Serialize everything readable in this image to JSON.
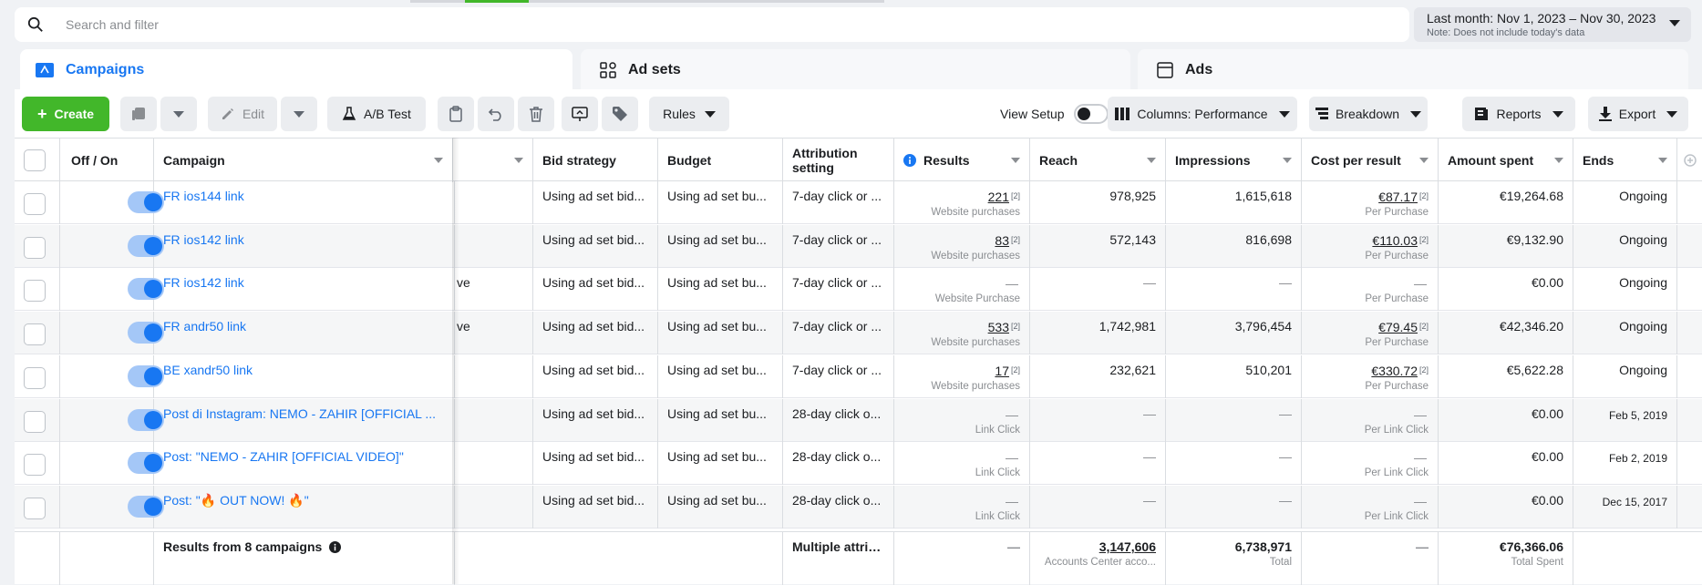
{
  "search": {
    "placeholder": "Search and filter"
  },
  "date_range": {
    "label": "Last month: Nov 1, 2023 – Nov 30, 2023",
    "note": "Note: Does not include today's data"
  },
  "tabs": [
    {
      "label": "Campaigns"
    },
    {
      "label": "Ad sets"
    },
    {
      "label": "Ads"
    }
  ],
  "toolbar": {
    "create": "Create",
    "edit": "Edit",
    "ab_test": "A/B Test",
    "rules": "Rules",
    "view_setup": "View Setup",
    "columns": "Columns: Performance",
    "breakdown": "Breakdown",
    "reports": "Reports",
    "export": "Export"
  },
  "columns": {
    "off_on": "Off / On",
    "campaign": "Campaign",
    "bid_strategy": "Bid strategy",
    "budget": "Budget",
    "attribution_line1": "Attribution",
    "attribution_line2": "setting",
    "results": "Results",
    "reach": "Reach",
    "impressions": "Impressions",
    "cost_per_result": "Cost per result",
    "amount_spent": "Amount spent",
    "ends": "Ends"
  },
  "rows": [
    {
      "name": "FR ios144 link",
      "delivery": "",
      "bid": "Using ad set bid...",
      "budget": "Using ad set bu...",
      "attribution": "7-day click or ...",
      "results": "221",
      "results_sup": "[2]",
      "results_sub": "Website purchases",
      "reach": "978,925",
      "impressions": "1,615,618",
      "cpr": "€87.17",
      "cpr_sup": "[2]",
      "cpr_sub": "Per Purchase",
      "spent": "€19,264.68",
      "ends": "Ongoing"
    },
    {
      "name": "FR ios142 link",
      "delivery": "",
      "bid": "Using ad set bid...",
      "budget": "Using ad set bu...",
      "attribution": "7-day click or ...",
      "results": "83",
      "results_sup": "[2]",
      "results_sub": "Website purchases",
      "reach": "572,143",
      "impressions": "816,698",
      "cpr": "€110.03",
      "cpr_sup": "[2]",
      "cpr_sub": "Per Purchase",
      "spent": "€9,132.90",
      "ends": "Ongoing"
    },
    {
      "name": "FR ios142 link",
      "delivery": "ve",
      "bid": "Using ad set bid...",
      "budget": "Using ad set bu...",
      "attribution": "7-day click or ...",
      "results": "—",
      "results_sup": "",
      "results_sub": "Website Purchase",
      "reach": "—",
      "impressions": "—",
      "cpr": "—",
      "cpr_sup": "",
      "cpr_sub": "Per Purchase",
      "spent": "€0.00",
      "ends": "Ongoing"
    },
    {
      "name": "FR andr50 link",
      "delivery": "ve",
      "bid": "Using ad set bid...",
      "budget": "Using ad set bu...",
      "attribution": "7-day click or ...",
      "results": "533",
      "results_sup": "[2]",
      "results_sub": "Website purchases",
      "reach": "1,742,981",
      "impressions": "3,796,454",
      "cpr": "€79.45",
      "cpr_sup": "[2]",
      "cpr_sub": "Per Purchase",
      "spent": "€42,346.20",
      "ends": "Ongoing"
    },
    {
      "name": "BE xandr50 link",
      "delivery": "",
      "bid": "Using ad set bid...",
      "budget": "Using ad set bu...",
      "attribution": "7-day click or ...",
      "results": "17",
      "results_sup": "[2]",
      "results_sub": "Website purchases",
      "reach": "232,621",
      "impressions": "510,201",
      "cpr": "€330.72",
      "cpr_sup": "[2]",
      "cpr_sub": "Per Purchase",
      "spent": "€5,622.28",
      "ends": "Ongoing"
    },
    {
      "name": "Post di Instagram: NEMO - ZAHIR [OFFICIAL ...",
      "delivery": "",
      "bid": "Using ad set bid...",
      "budget": "Using ad set bu...",
      "attribution": "28-day click o...",
      "results": "—",
      "results_sup": "",
      "results_sub": "Link Click",
      "reach": "—",
      "impressions": "—",
      "cpr": "—",
      "cpr_sup": "",
      "cpr_sub": "Per Link Click",
      "spent": "€0.00",
      "ends": "Feb 5, 2019"
    },
    {
      "name": "Post: \"NEMO - ZAHIR [OFFICIAL VIDEO]\"",
      "delivery": "",
      "bid": "Using ad set bid...",
      "budget": "Using ad set bu...",
      "attribution": "28-day click o...",
      "results": "—",
      "results_sup": "",
      "results_sub": "Link Click",
      "reach": "—",
      "impressions": "—",
      "cpr": "—",
      "cpr_sup": "",
      "cpr_sub": "Per Link Click",
      "spent": "€0.00",
      "ends": "Feb 2, 2019"
    },
    {
      "name": "Post: \"🔥 OUT NOW! 🔥\"",
      "delivery": "",
      "bid": "Using ad set bid...",
      "budget": "Using ad set bu...",
      "attribution": "28-day click o...",
      "results": "—",
      "results_sup": "",
      "results_sub": "Link Click",
      "reach": "—",
      "impressions": "—",
      "cpr": "—",
      "cpr_sup": "",
      "cpr_sub": "Per Link Click",
      "spent": "€0.00",
      "ends": "Dec 15, 2017"
    }
  ],
  "summary": {
    "label": "Results from 8 campaigns",
    "attribution": "Multiple attrib...",
    "results": "—",
    "reach": "3,147,606",
    "reach_sub": "Accounts Center acco...",
    "impressions": "6,738,971",
    "impressions_sub": "Total",
    "cpr": "—",
    "spent": "€76,366.06",
    "spent_sub": "Total Spent"
  },
  "colors": {
    "accent": "#1877f2",
    "create": "#42b72a",
    "toggle_on": "#1877f2"
  }
}
